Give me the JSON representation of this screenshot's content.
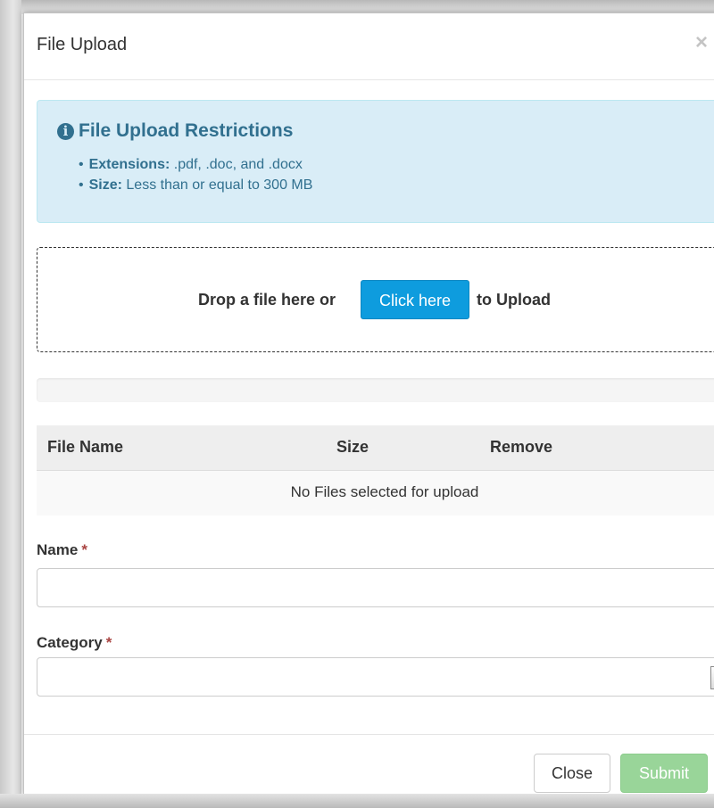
{
  "modal": {
    "title": "File Upload",
    "close_icon": "×"
  },
  "restrictions": {
    "icon": "info-icon",
    "heading": "File Upload Restrictions",
    "items": [
      {
        "label": "Extensions:",
        "value": " .pdf, .doc, and .docx"
      },
      {
        "label": "Size:",
        "value": " Less than or equal to 300 MB"
      }
    ]
  },
  "dropzone": {
    "text_before": "Drop a file here or",
    "button_label": "Click here",
    "text_after": "to Upload"
  },
  "progress": {
    "value": 0
  },
  "file_table": {
    "columns": [
      "File Name",
      "Size",
      "Remove"
    ],
    "empty_message": "No Files selected for upload"
  },
  "form": {
    "name_label": "Name",
    "category_label": "Category",
    "required_marker": "*",
    "name_value": "",
    "category_value": ""
  },
  "footer": {
    "close_label": "Close",
    "submit_label": "Submit"
  },
  "colors": {
    "info_background": "#d9edf7",
    "info_text": "#31708f",
    "primary_button": "#0e9cde",
    "submit_disabled": "#99d599",
    "required": "#a94442"
  }
}
